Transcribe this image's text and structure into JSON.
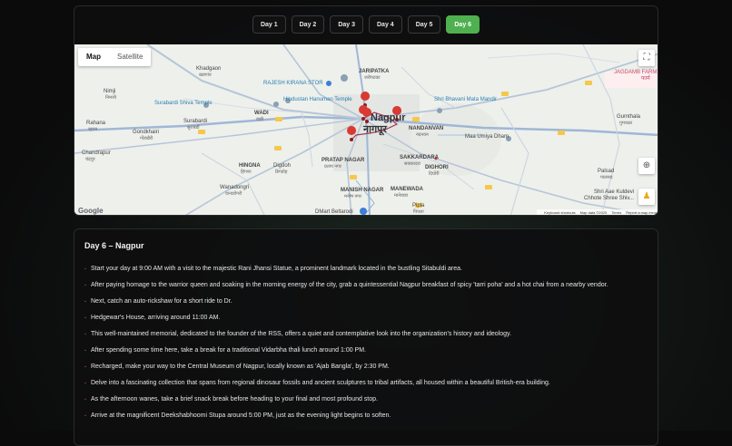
{
  "tabs": [
    "Day 1",
    "Day 2",
    "Day 3",
    "Day 4",
    "Day 5",
    "Day 6"
  ],
  "active_tab": 5,
  "map": {
    "type_controls": {
      "map": "Map",
      "satellite": "Satellite"
    },
    "labels": {
      "khadgaon_en": "Khadgaon",
      "khadgaon_hi": "खडगांव",
      "nimji_en": "Nimji",
      "nimji_hi": "निमजी",
      "surabardi_shiva": "Surabardi Shiva Temple",
      "surabardi_en": "Surabardi",
      "surabardi_hi": "सुराबर्डी",
      "gondkhairi_en": "Gondkhairi",
      "gondkhairi_hi": "गोंडखैरी",
      "rahana_en": "Rahana",
      "rahana_hi": "रहाना",
      "chandrapur_en": "Chandrapur",
      "chandrapur_hi": "चंद्रपुर",
      "wadi_en": "WADI",
      "wadi_hi": "वाडी",
      "rajesh_kirana": "RAJESH KIRANA STOR",
      "jaripatka_en": "JARIPATKA",
      "jaripatka_hi": "जरीपटका",
      "hindustan_hanuman": "Hindustan Hanuman Temple",
      "nagpur_en": "Nagpur",
      "nagpur_hi": "नागपूर",
      "nandanvan_en": "NANDANVAN",
      "nandanvan_hi": "नंदनवन",
      "shri_bhavani": "Shri Bhavani Mata Mandir",
      "maa_umiya": "Maa Umiya Dham",
      "jagdamb": "JAGDAMB FARM",
      "jagdamb_hi": "फार्म",
      "gumthala_en": "Gumthala",
      "gumthala_hi": "गुमथळा",
      "hingna_en": "HINGNA",
      "hingna_hi": "हिंगणा",
      "digdoh_en": "Digdoh",
      "digdoh_hi": "डिगडोह",
      "pratap_en": "PRATAP NAGAR",
      "pratap_hi": "प्रताप नगर",
      "sakkardara_en": "SAKKARDARA",
      "sakkardara_hi": "सक्करदरा",
      "dighori_en": "DIGHORI",
      "dighori_hi": "दिघोरी",
      "palsad_en": "Palsad",
      "palsad_hi": "पालसद",
      "wanadongri_en": "Wanadongri",
      "wanadongri_hi": "वानाडोंगरी",
      "manish_en": "MANISH NAGAR",
      "manish_hi": "मनीष नगर",
      "manewada_en": "MANEWADA",
      "manewada_hi": "मानेवाडा",
      "shri_aae": "Shri Aae Kuldevi",
      "chhote": "Chhote Shree Shiv...",
      "dmart": "DMart Beltarodi",
      "pipla_en": "Pipla",
      "pipla_hi": "पिपला",
      "google": "Google"
    },
    "attribution": [
      "Keyboard shortcuts",
      "Map data ©2025",
      "Terms",
      "Report a map error"
    ]
  },
  "itinerary": {
    "title": "Day 6 – Nagpur",
    "items": [
      "Start your day at 9:00 AM with a visit to the majestic Rani Jhansi Statue, a prominent landmark located in the bustling Sitabuldi area.",
      "After paying homage to the warrior queen and soaking in the morning energy of the city, grab a quintessential Nagpur breakfast of spicy 'tarri poha' and a hot chai from a nearby vendor.",
      "Next, catch an auto-rickshaw for a short ride to Dr.",
      "Hedgewar's House, arriving around 11:00 AM.",
      "This well-maintained memorial, dedicated to the founder of the RSS, offers a quiet and contemplative look into the organization's history and ideology.",
      "After spending some time here, take a break for a traditional Vidarbha thali lunch around 1:00 PM.",
      "Recharged, make your way to the Central Museum of Nagpur, locally known as 'Ajab Bangla', by 2:30 PM.",
      "Delve into a fascinating collection that spans from regional dinosaur fossils and ancient sculptures to tribal artifacts, all housed within a beautiful British-era building.",
      "As the afternoon wanes, take a brief snack break before heading to your final and most profound stop.",
      "Arrive at the magnificent Deekshabhoomi Stupa around 5:00 PM, just as the evening light begins to soften."
    ]
  }
}
